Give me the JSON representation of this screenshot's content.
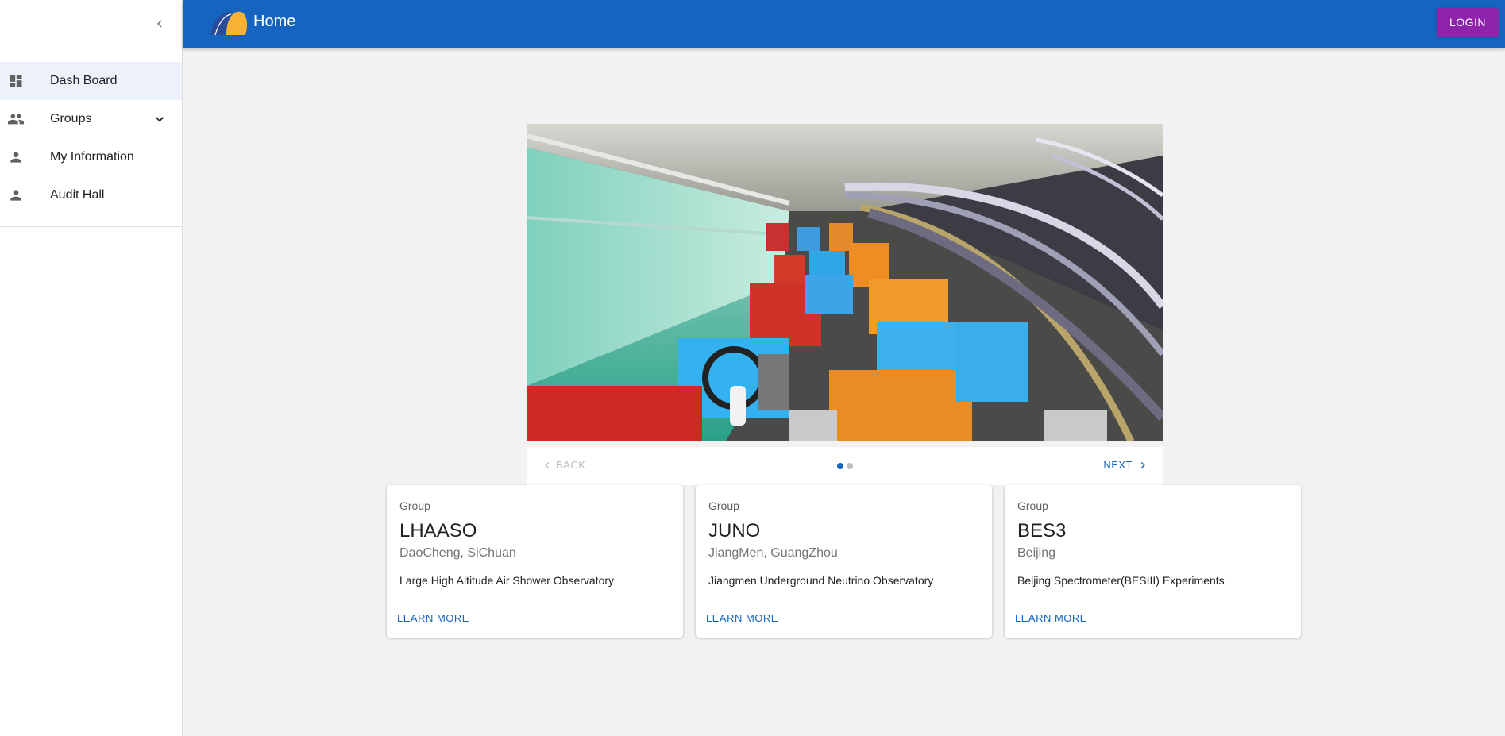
{
  "sidebar": {
    "items": [
      {
        "label": "Dash Board",
        "icon": "dashboard-icon"
      },
      {
        "label": "Groups",
        "icon": "groups-icon"
      },
      {
        "label": "My Information",
        "icon": "person-icon"
      },
      {
        "label": "Audit Hall",
        "icon": "person-icon"
      }
    ]
  },
  "appbar": {
    "title": "Home",
    "login_label": "LOGIN"
  },
  "carousel": {
    "back_label": "BACK",
    "next_label": "NEXT",
    "steps": 2,
    "active_step": 1
  },
  "cards": [
    {
      "overline": "Group",
      "title": "LHAASO",
      "subtitle": "DaoCheng, SiChuan",
      "description": "Large High Altitude Air Shower Observatory",
      "action": "LEARN MORE"
    },
    {
      "overline": "Group",
      "title": "JUNO",
      "subtitle": "JiangMen, GuangZhou",
      "description": "Jiangmen Underground Neutrino Observatory",
      "action": "LEARN MORE"
    },
    {
      "overline": "Group",
      "title": "BES3",
      "subtitle": "Beijing",
      "description": "Beijing Spectrometer(BESIII) Experiments",
      "action": "LEARN MORE"
    }
  ],
  "colors": {
    "primary": "#1565c0",
    "secondary": "#8e24aa",
    "background": "#f2f2f2"
  }
}
